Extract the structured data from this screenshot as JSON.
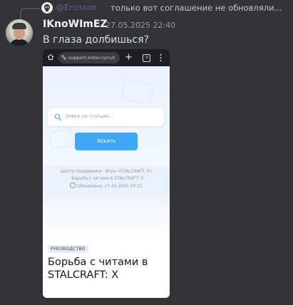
{
  "reply": {
    "author": "@Ericsson",
    "text": "только вот соглашение не обновляли..."
  },
  "message": {
    "username": "IKnoWImEZ",
    "timestamp": "27.05.2025 22:40",
    "text": "В глаза долбишься?"
  },
  "embed": {
    "browser": {
      "url": "support.exbo.ru/ru/t",
      "tab_count": ":D"
    },
    "search": {
      "placeholder": "Поиск по статьям...",
      "button_label": "Искать"
    },
    "breadcrumbs": {
      "line1": "Центр поддержки · Игра «STALCRAFT: X»",
      "line2": "· Борьба с читами в STALCRAFT: X",
      "updated": "Обновлено: 27.05.2025 10:21"
    },
    "article": {
      "badge": "РУКОВОДСТВО",
      "title": "Борьба с читами в STALCRAFT: X"
    }
  },
  "colors": {
    "background": "#313338",
    "username": "#f2f3f5",
    "accent_button": "#3fa9f5"
  }
}
